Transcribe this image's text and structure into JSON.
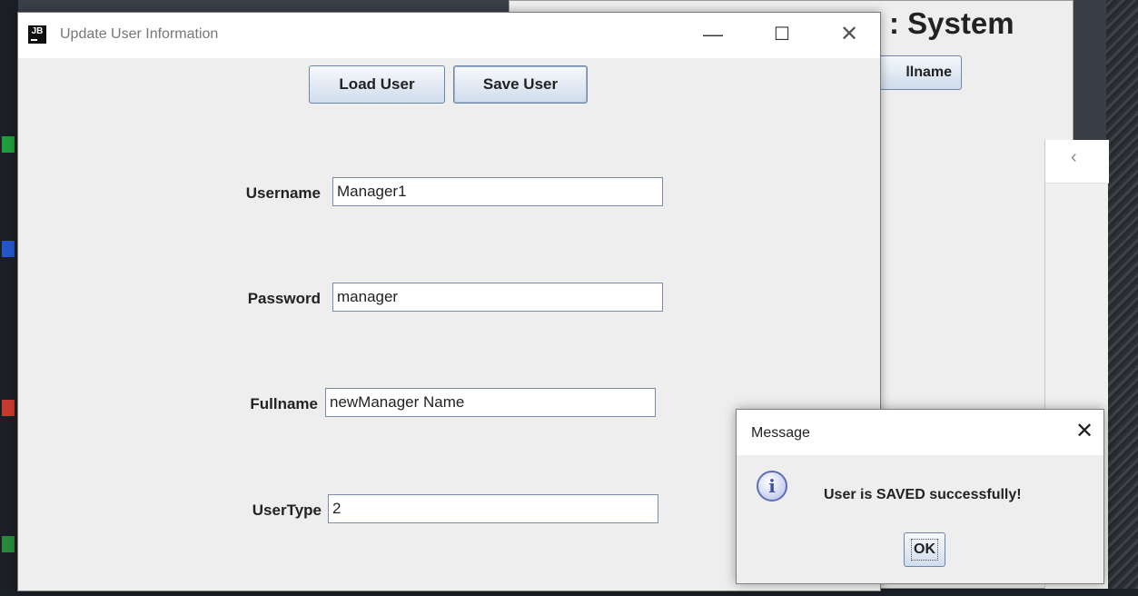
{
  "background_window": {
    "title_fragment": ": System",
    "button_fragment": "llname"
  },
  "dialog": {
    "title": "Update User Information",
    "icon_text": "JB",
    "controls": {
      "minimize": "—",
      "maximize": "☐",
      "close": "✕"
    },
    "toolbar": {
      "load_label": "Load User",
      "save_label": "Save User"
    },
    "fields": [
      {
        "label": "Username",
        "value": "Manager1"
      },
      {
        "label": "Password",
        "value": "manager"
      },
      {
        "label": "Fullname",
        "value": "newManager Name"
      },
      {
        "label": "UserType",
        "value": "2"
      }
    ]
  },
  "message": {
    "title": "Message",
    "close": "✕",
    "icon": "i",
    "text": "User is SAVED successfully!",
    "ok_label": "OK"
  },
  "colors": {
    "button_border": "#6d86a6",
    "button_gradient_top": "#f7f9fc",
    "button_gradient_bottom": "#d0dcec",
    "window_bg": "#eeeeee",
    "info_icon": "#5d6fb4"
  }
}
